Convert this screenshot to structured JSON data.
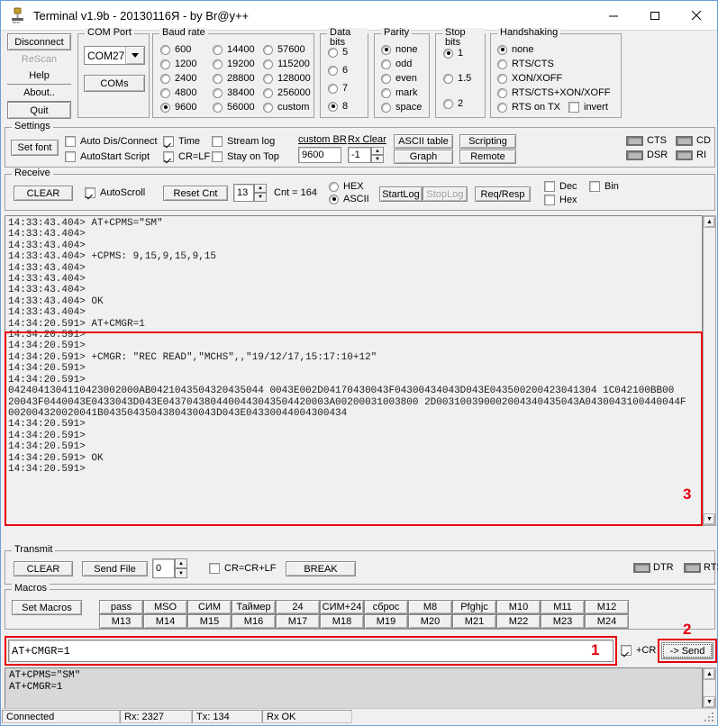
{
  "window": {
    "title": "Terminal v1.9b - 20130116Я - by Br@y++",
    "icon": "terminal-app-icon",
    "minimize": "—",
    "maximize": "▢",
    "close": "✕"
  },
  "left_buttons": [
    {
      "name": "disconnect",
      "label": "Disconnect",
      "disabled": false
    },
    {
      "name": "rescan",
      "label": "ReScan",
      "disabled": true
    },
    {
      "name": "help",
      "label": "Help",
      "disabled": false
    },
    {
      "name": "about",
      "label": "About..",
      "disabled": false
    },
    {
      "name": "quit",
      "label": "Quit",
      "disabled": false
    }
  ],
  "com_port": {
    "legend": "COM Port",
    "selected": "COM27",
    "coms_button": "COMs"
  },
  "baud_rate": {
    "legend": "Baud rate",
    "selected": "9600",
    "col1": [
      "600",
      "1200",
      "2400",
      "4800",
      "9600"
    ],
    "col2": [
      "14400",
      "19200",
      "28800",
      "38400",
      "56000"
    ],
    "col3": [
      "57600",
      "115200",
      "128000",
      "256000",
      "custom"
    ]
  },
  "data_bits": {
    "legend": "Data bits",
    "selected": "8",
    "options": [
      "5",
      "6",
      "7",
      "8"
    ]
  },
  "parity": {
    "legend": "Parity",
    "selected": "none",
    "options": [
      "none",
      "odd",
      "even",
      "mark",
      "space"
    ]
  },
  "stop_bits": {
    "legend": "Stop bits",
    "selected": "1",
    "options": [
      "1",
      "1.5",
      "2"
    ]
  },
  "handshaking": {
    "legend": "Handshaking",
    "selected": "none",
    "options": [
      "none",
      "RTS/CTS",
      "XON/XOFF",
      "RTS/CTS+XON/XOFF",
      "RTS on TX"
    ],
    "invert_label": "invert",
    "invert_checked": false
  },
  "settings": {
    "legend": "Settings",
    "set_font": "Set font",
    "auto_disconnect": {
      "label": "Auto Dis/Connect",
      "checked": false
    },
    "autostart_script": {
      "label": "AutoStart Script",
      "checked": false
    },
    "time": {
      "label": "Time",
      "checked": true
    },
    "crlf": {
      "label": "CR=LF",
      "checked": true
    },
    "stream_log": {
      "label": "Stream log",
      "checked": false
    },
    "stay_on_top": {
      "label": "Stay on Top",
      "checked": false
    },
    "custom_br_label": "custom BR",
    "custom_br_value": "9600",
    "rx_clear_label": "Rx Clear",
    "rx_clear_value": "-1",
    "ascii_table": "ASCII table",
    "scripting": "Scripting",
    "graph": "Graph",
    "remote": "Remote",
    "leds": [
      "CTS",
      "CD",
      "DSR",
      "RI"
    ]
  },
  "receive": {
    "legend": "Receive",
    "clear": "CLEAR",
    "autoscroll": {
      "label": "AutoScroll",
      "checked": true
    },
    "reset_cnt": "Reset Cnt",
    "cnt_field": "13",
    "cnt_label": "Cnt = 164",
    "hex_radio": "HEX",
    "ascii_radio": "ASCII",
    "mode_selected": "ASCII",
    "start_log": "StartLog",
    "stop_log": "StopLog",
    "stop_log_disabled": true,
    "req_resp": "Req/Resp",
    "dec": {
      "label": "Dec",
      "checked": false
    },
    "hex": {
      "label": "Hex",
      "checked": false
    },
    "bin": {
      "label": "Bin",
      "checked": false
    }
  },
  "terminal": {
    "lines_before": [
      "14:33:43.404> AT+CPMS=\"SM\"",
      "14:33:43.404>",
      "14:33:43.404>",
      "14:33:43.404> +CPMS: 9,15,9,15,9,15",
      "14:33:43.404>",
      "14:33:43.404>",
      "14:33:43.404>",
      "14:33:43.404> OK",
      "14:33:43.404>"
    ],
    "lines_highlighted": [
      "14:34:20.591> AT+CMGR=1",
      "14:34:20.591>",
      "14:34:20.591>",
      "14:34:20.591> +CMGR: \"REC READ\",\"MCHS\",,\"19/12/17,15:17:10+12\"",
      "14:34:20.591>",
      "14:34:20.591>",
      "0424041304110423002000AB0421043504320435044 0043E002D04170430043F04300434043D043E043500200423041304 1C042100BB00",
      "20043F0440043E0433043D043E0437043804400443043504420003A00200031003800 2D003100390002004340435043A0430043100440044F",
      "002004320020041B0435043504380430043D043E04330044004300434",
      "14:34:20.591>",
      "14:34:20.591>",
      "14:34:20.591>",
      "14:34:20.591> OK",
      "14:34:20.591>"
    ]
  },
  "transmit": {
    "legend": "Transmit",
    "clear": "CLEAR",
    "send_file": "Send File",
    "delay_value": "0",
    "crcrlf": {
      "label": "CR=CR+LF",
      "checked": false
    },
    "break": "BREAK",
    "leds": [
      "DTR",
      "RTS"
    ]
  },
  "macros": {
    "legend": "Macros",
    "set_macros": "Set Macros",
    "row1": [
      "pass",
      "MSO",
      "СИМ",
      "Таймер",
      "24",
      "СИМ+24",
      "сброс",
      "M8",
      "Pfghjc",
      "M10",
      "M11",
      "M12"
    ],
    "row2": [
      "M13",
      "M14",
      "M15",
      "M16",
      "M17",
      "M18",
      "M19",
      "M20",
      "M21",
      "M22",
      "M23",
      "M24"
    ]
  },
  "send_bar": {
    "input_value": "AT+CMGR=1",
    "cr_checkbox": {
      "label": "+CR",
      "checked": true
    },
    "send_button": "-> Send"
  },
  "history": [
    "AT+CPMS=\"SM\"",
    "AT+CMGR=1"
  ],
  "status_bar": {
    "connection": "Connected",
    "rx": "Rx: 2327",
    "tx": "Tx: 134",
    "state": "Rx OK"
  },
  "annotations": {
    "one": "1",
    "two": "2",
    "three": "3",
    "color": "#e8000d"
  }
}
